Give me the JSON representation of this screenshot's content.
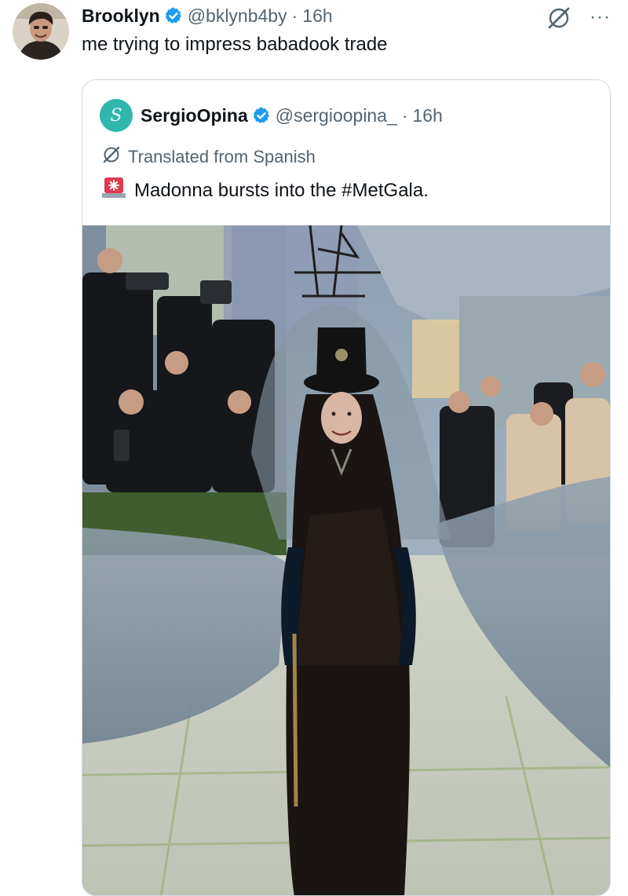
{
  "tweet": {
    "author_name": "Brooklyn",
    "author_handle": "@bklynb4by",
    "separator": "·",
    "time": "16h",
    "text": "me trying to impress babadook trade",
    "more_label": "···"
  },
  "quote": {
    "author_name": "SergioOpina",
    "author_handle": "@sergioopina_",
    "separator": "·",
    "time": "16h",
    "translated_label": "Translated from Spanish",
    "text": "Madonna bursts into the #MetGala.",
    "avatar_letter": "S"
  },
  "colors": {
    "verified": "#1d9bf0",
    "muted": "#536471",
    "border": "#cfd9de",
    "quote_avatar": "#2fb6ad"
  },
  "icons": {
    "verified": "verified-badge-icon",
    "grok": "grok-icon",
    "more": "more-options-icon",
    "translate": "translate-icon",
    "siren": "siren-emoji-icon"
  }
}
